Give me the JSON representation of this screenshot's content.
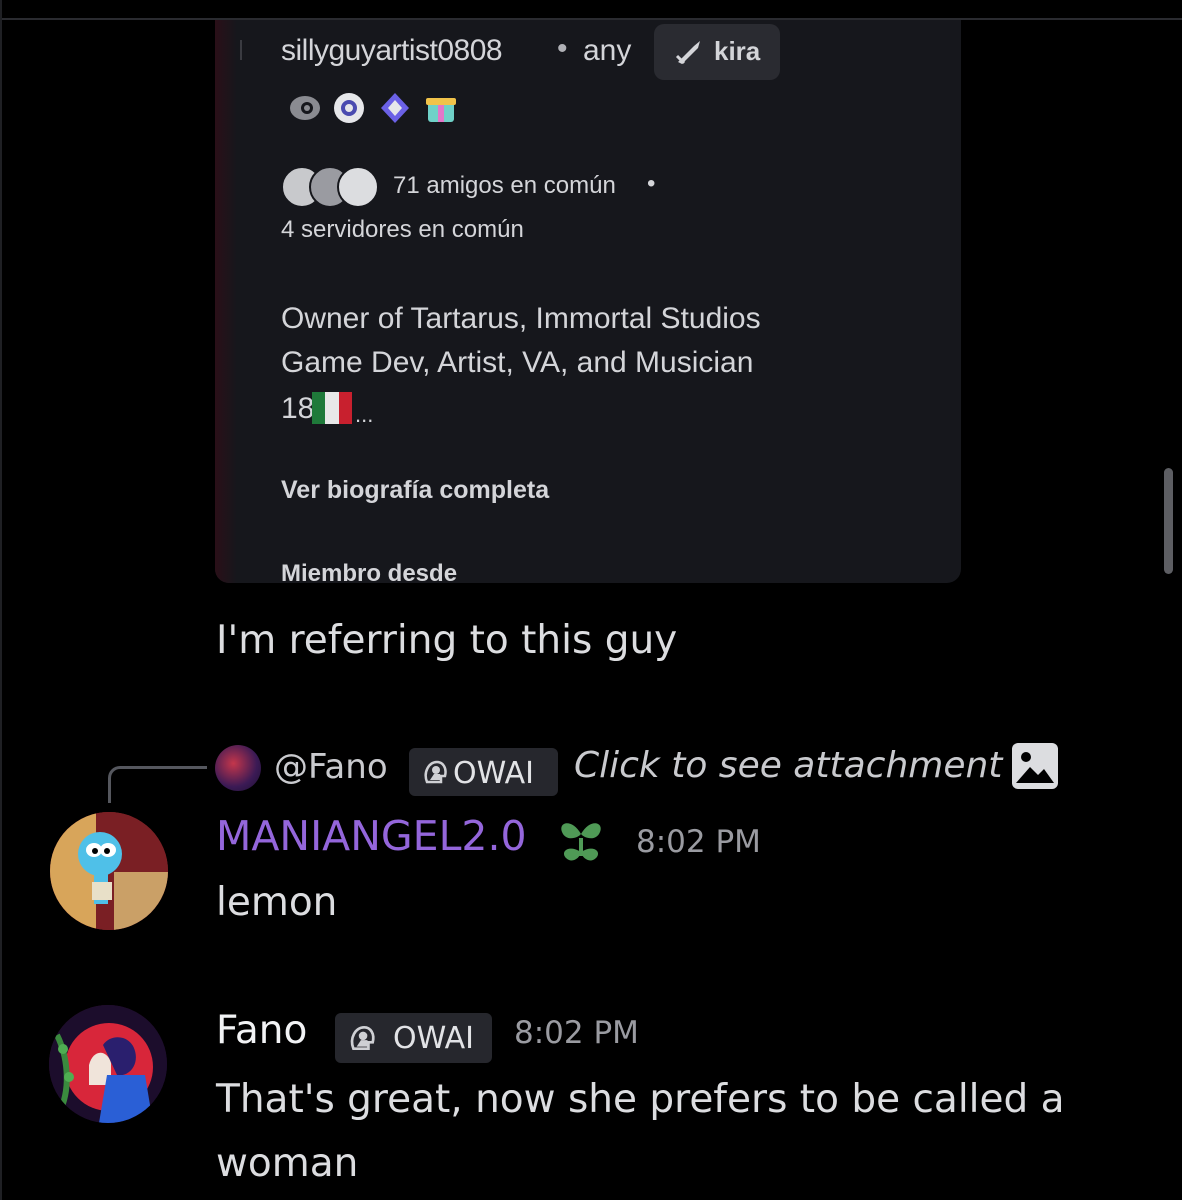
{
  "embed": {
    "username": "sillyguyartist0808",
    "separator": "•",
    "pronouns": "any",
    "tag_label": "kira",
    "badges": [
      "hypesquad-icon",
      "nitro-icon",
      "boost-icon",
      "quest-gift-icon"
    ],
    "mutual_friends": "71 amigos en común",
    "mutual_separator": "•",
    "mutual_servers": "4 servidores en común",
    "bio_line1": "Owner of Tartarus, Immortal Studios",
    "bio_line2": "Game Dev, Artist, VA, and Musician",
    "bio_line3": "18",
    "bio_ellipsis": "...",
    "full_bio_link": "Ver biografía completa",
    "member_since": "Miembro desde"
  },
  "messages": {
    "first_text": "I'm referring to this guy",
    "reply": {
      "user": "@Fano",
      "tag": "OWAI",
      "preview": "Click to see attachment"
    },
    "second": {
      "username": "MANIANGEL2.0",
      "username_color": "#9466db",
      "time": "8:02 PM",
      "text": "lemon"
    },
    "third": {
      "username": "Fano",
      "tag": "OWAI",
      "time": "8:02 PM",
      "text": "That's great, now she prefers to be called a woman"
    }
  }
}
